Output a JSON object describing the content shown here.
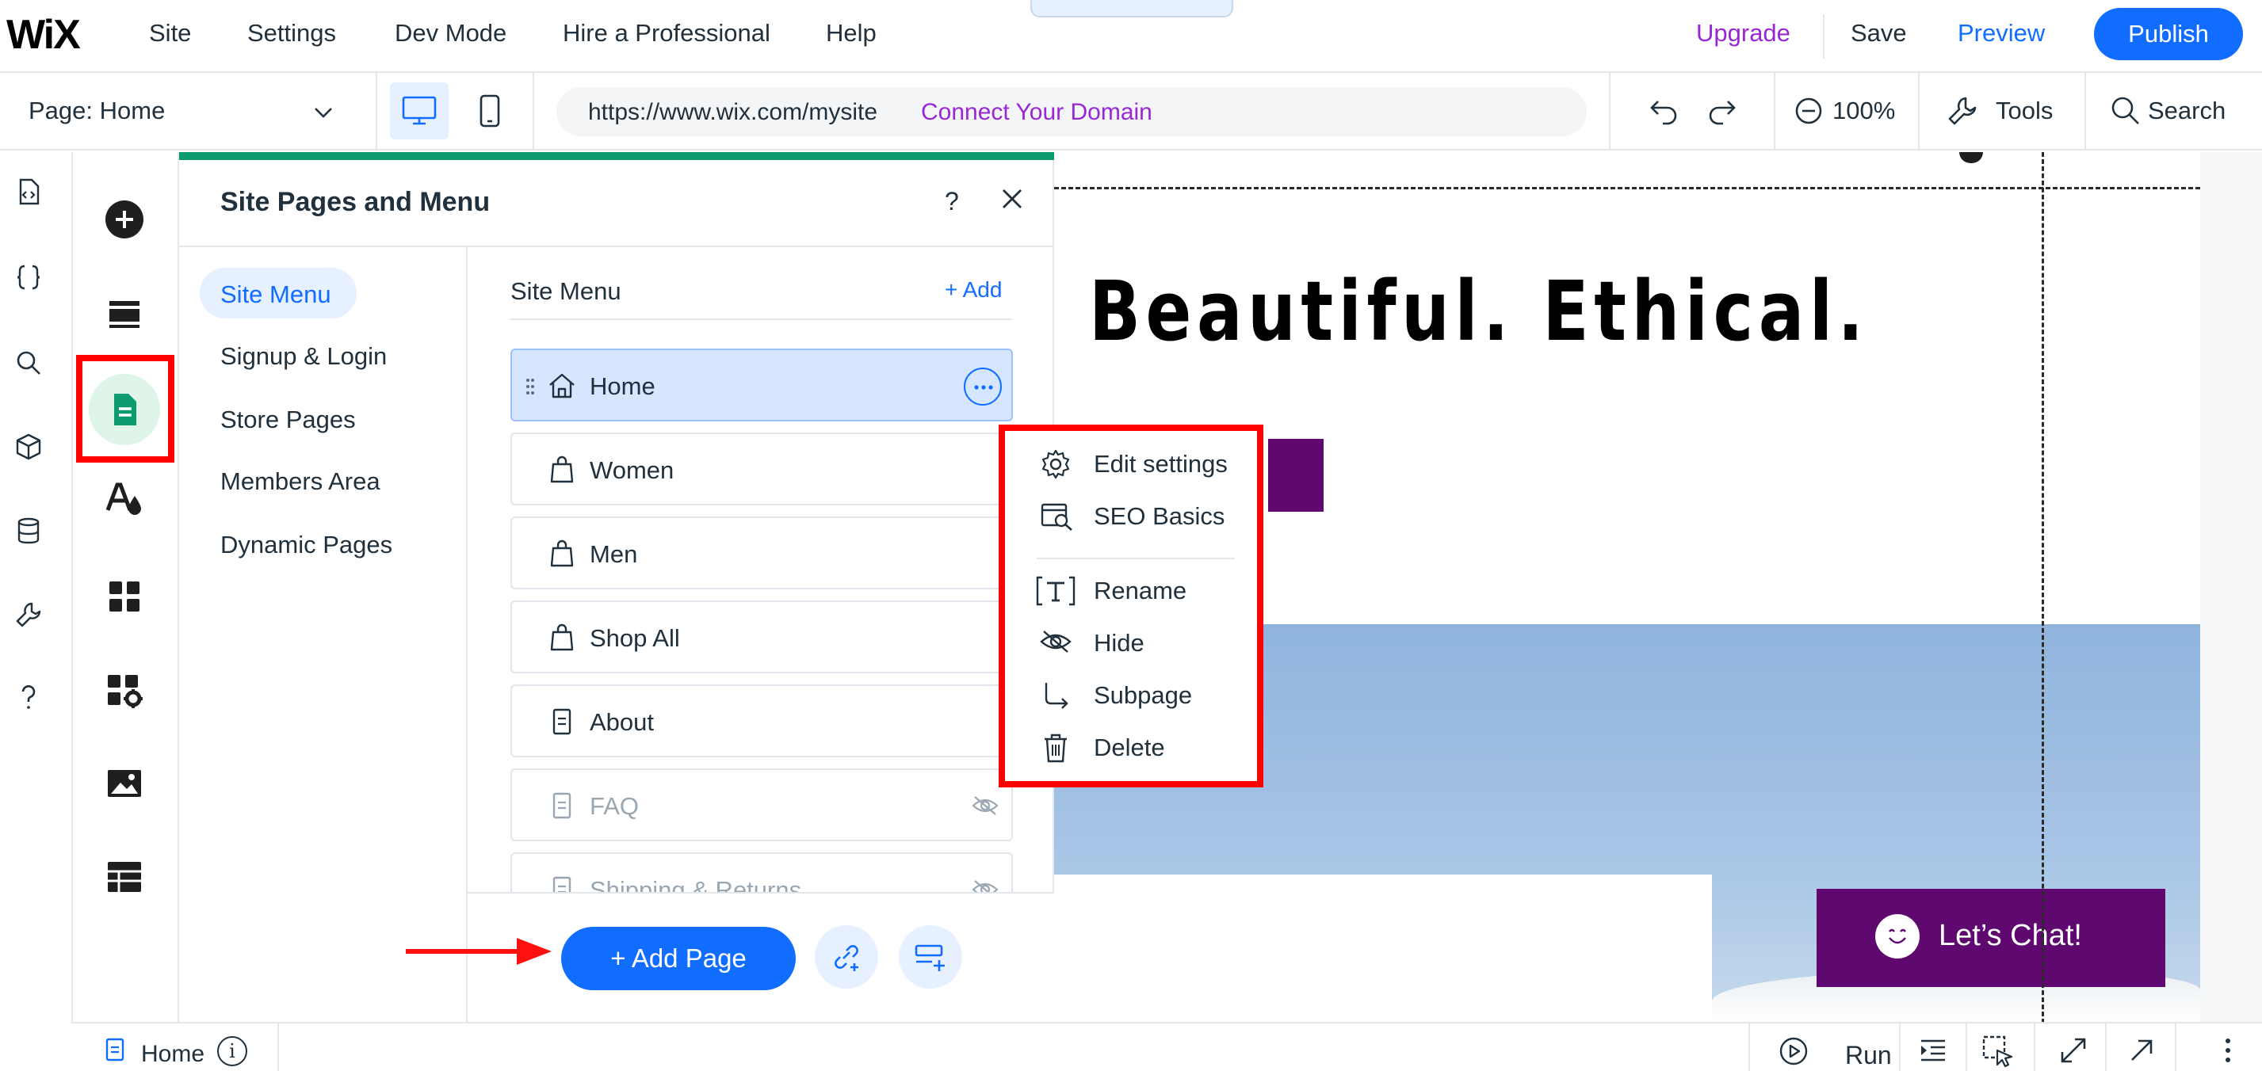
{
  "topbar": {
    "logo": "WiX",
    "menu": [
      "Site",
      "Settings",
      "Dev Mode",
      "Hire a Professional",
      "Help"
    ],
    "collapse_glyph": "⌃",
    "upgrade": "Upgrade",
    "save": "Save",
    "preview": "Preview",
    "publish": "Publish"
  },
  "toolbar": {
    "page_select": "Page: Home",
    "url": "https://www.wix.com/mysite",
    "connect_domain": "Connect Your Domain",
    "zoom": "100%",
    "tools": "Tools",
    "search": "Search"
  },
  "rail_icons": [
    "code-page-icon",
    "braces-icon",
    "search-icon",
    "package-icon",
    "database-icon",
    "wrench-icon",
    "help-icon"
  ],
  "panel": {
    "title": "Site Pages and Menu",
    "help": "?",
    "categories": [
      "Site Menu",
      "Signup & Login",
      "Store Pages",
      "Members Area",
      "Dynamic Pages"
    ],
    "menu_header": "Site Menu",
    "add": "+ Add",
    "pages": [
      {
        "label": "Home",
        "icon": "home-icon",
        "state": "active"
      },
      {
        "label": "Women",
        "icon": "bag-icon",
        "state": "normal"
      },
      {
        "label": "Men",
        "icon": "bag-icon",
        "state": "normal"
      },
      {
        "label": "Shop All",
        "icon": "bag-icon",
        "state": "normal"
      },
      {
        "label": "About",
        "icon": "page-icon",
        "state": "normal"
      },
      {
        "label": "FAQ",
        "icon": "page-icon",
        "state": "hidden"
      },
      {
        "label": "Shipping & Returns",
        "icon": "page-icon",
        "state": "hidden"
      }
    ],
    "add_page": "+ Add Page"
  },
  "context_menu": [
    "Edit settings",
    "SEO Basics",
    "Rename",
    "Hide",
    "Subpage",
    "Delete"
  ],
  "canvas": {
    "headline": "Beautiful. Ethical.",
    "chat": "Let’s Chat!"
  },
  "bottombar": {
    "page": "Home",
    "info": "i",
    "run": "Run"
  },
  "colors": {
    "accent_blue": "#116dff",
    "upgrade_purple": "#9a27d5",
    "panel_green": "#0c9b6f",
    "brand_purple": "#5e0870",
    "highlight_red": "#ff0000"
  }
}
